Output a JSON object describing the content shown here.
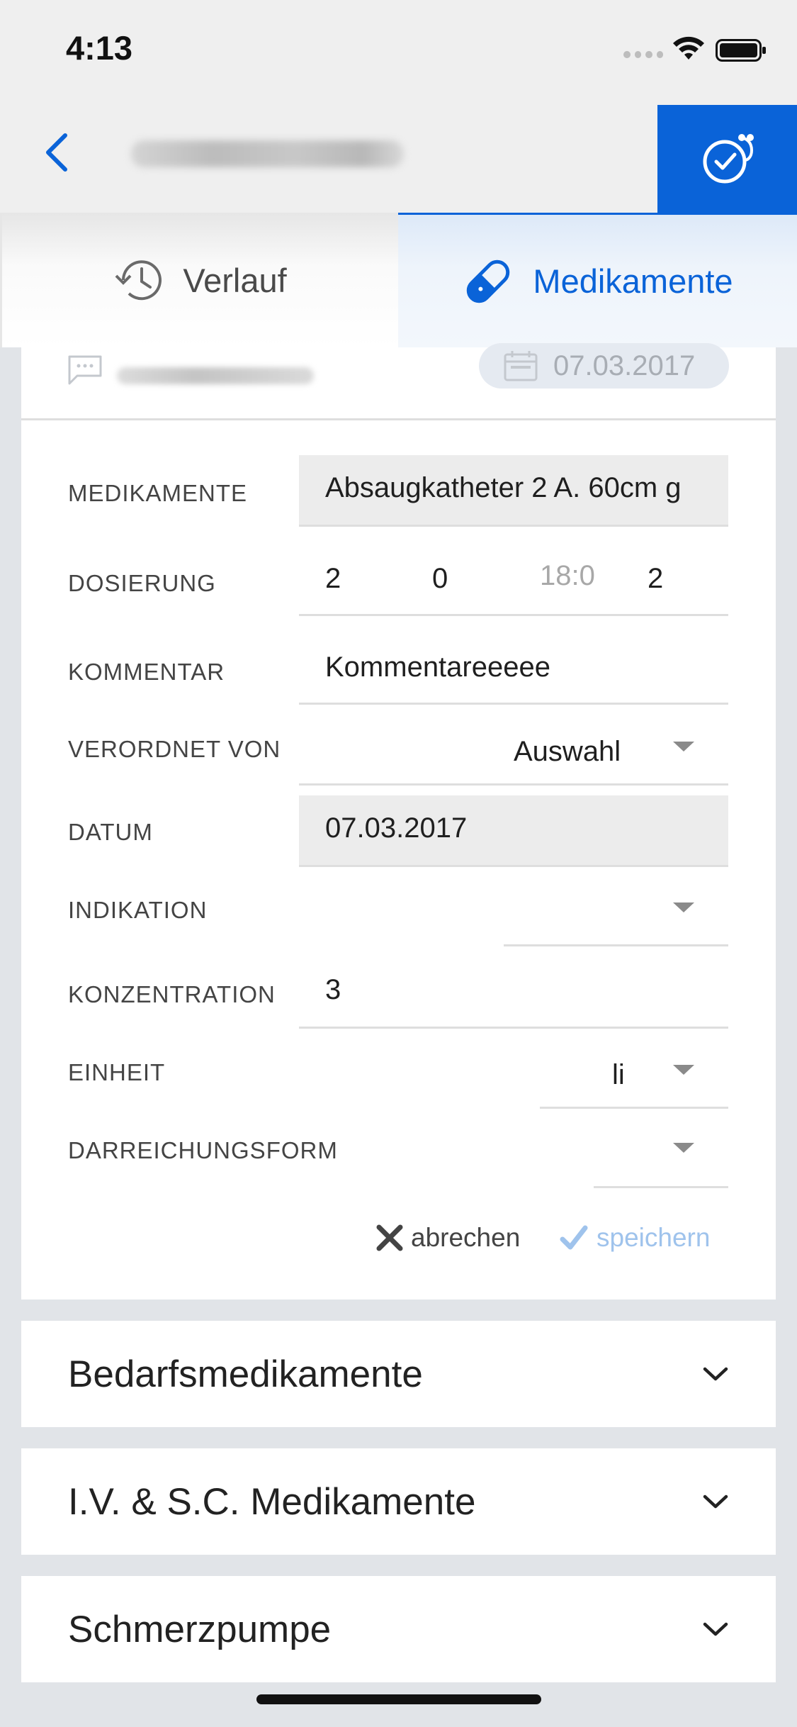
{
  "status": {
    "time": "4:13"
  },
  "tabs": [
    {
      "label": "Verlauf",
      "icon": "history-icon"
    },
    {
      "label": "Medikamente",
      "icon": "pill-icon",
      "active": true
    }
  ],
  "card": {
    "date_badge": "07.03.2017"
  },
  "form": {
    "medikamente": {
      "label": "MEDIKAMENTE",
      "value": "Absaugkatheter 2 A. 60cm g"
    },
    "dosierung": {
      "label": "DOSIERUNG",
      "values": [
        "2",
        "0",
        "2"
      ],
      "placeholder": "18:0"
    },
    "kommentar": {
      "label": "KOMMENTAR",
      "value": "Kommentareeeee"
    },
    "verordnet_von": {
      "label": "VERORDNET VON",
      "value": "Auswahl"
    },
    "datum": {
      "label": "DATUM",
      "value": "07.03.2017"
    },
    "indikation": {
      "label": "INDIKATION",
      "value": ""
    },
    "konzentration": {
      "label": "KONZENTRATION",
      "value": "3"
    },
    "einheit": {
      "label": "EINHEIT",
      "value": "li"
    },
    "darreichungsform": {
      "label": "DARREICHUNGSFORM",
      "value": ""
    }
  },
  "actions": {
    "cancel": "abrechen",
    "save": "speichern"
  },
  "sections": [
    {
      "label": "Bedarfsmedikamente"
    },
    {
      "label": "I.V. & S.C. Medikamente"
    },
    {
      "label": "Schmerzpumpe"
    }
  ],
  "colors": {
    "accent": "#0a63d8",
    "background": "#e1e4e8"
  }
}
